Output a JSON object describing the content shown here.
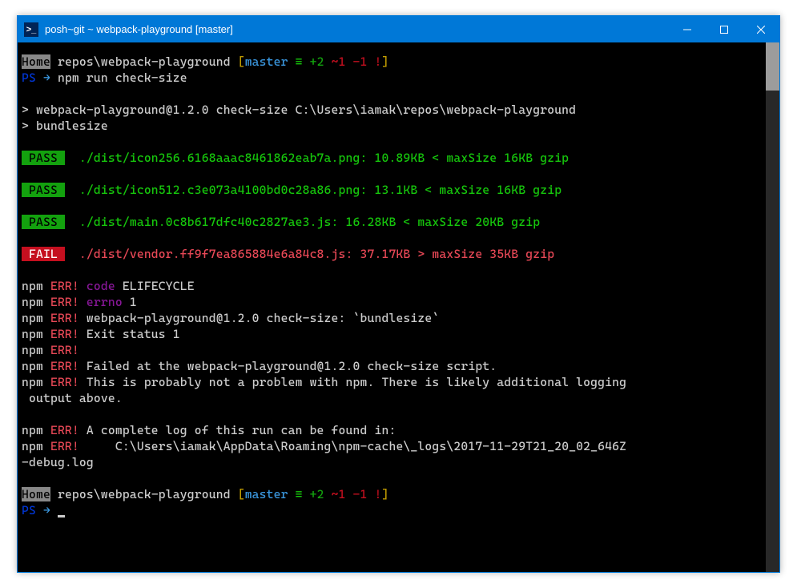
{
  "titlebar": {
    "title": "posh~git ~ webpack-playground [master]"
  },
  "prompt1": {
    "home": "Home",
    "path": " repos\\webpack-playground ",
    "branch_open": "[",
    "branch": "master",
    "equiv": " ≡ ",
    "add": "+2",
    "mod": " ~1 ",
    "del": "-1 ",
    "bang": "!",
    "branch_close": "]",
    "ps": "PS",
    "arrow": " → ",
    "cmd": "npm run check-size"
  },
  "npmheader": {
    "line1": "> webpack-playground@1.2.0 check-size C:\\Users\\iamak\\repos\\webpack-playground",
    "line2": "> bundlesize"
  },
  "results": [
    {
      "badge": " PASS ",
      "pass": true,
      "text": "  ./dist/icon256.6168aaac8461862eab7a.png: 10.89KB < maxSize 16KB gzip"
    },
    {
      "badge": " PASS ",
      "pass": true,
      "text": "  ./dist/icon512.c3e073a4100bd0c28a86.png: 13.1KB < maxSize 16KB gzip"
    },
    {
      "badge": " PASS ",
      "pass": true,
      "text": "  ./dist/main.0c8b617dfc40c2827ae3.js: 16.28KB < maxSize 20KB gzip"
    },
    {
      "badge": " FAIL ",
      "pass": false,
      "text": "  ./dist/vendor.ff9f7ea865884e6a84c8.js: 37.17KB > maxSize 35KB gzip"
    }
  ],
  "errors": {
    "npm": "npm",
    "err": " ERR!",
    "code_label": " code",
    "code_val": " ELIFECYCLE",
    "errno_label": " errno",
    "errno_val": " 1",
    "line3": " webpack-playground@1.2.0 check-size: `bundlesize`",
    "line4": " Exit status 1",
    "line6": " Failed at the webpack-playground@1.2.0 check-size script.",
    "line7a": " This is probably not a problem with npm. There is likely additional logging",
    "line7b": " output above.",
    "line9": " A complete log of this run can be found in:",
    "line10a": "     C:\\Users\\iamak\\AppData\\Roaming\\npm-cache\\_logs\\2017-11-29T21_20_02_646Z",
    "line10b": "-debug.log"
  },
  "prompt2": {
    "home": "Home",
    "path": " repos\\webpack-playground ",
    "branch_open": "[",
    "branch": "master",
    "equiv": " ≡ ",
    "add": "+2",
    "mod": " ~1 ",
    "del": "-1 ",
    "bang": "!",
    "branch_close": "]",
    "ps": "PS",
    "arrow": " → "
  }
}
